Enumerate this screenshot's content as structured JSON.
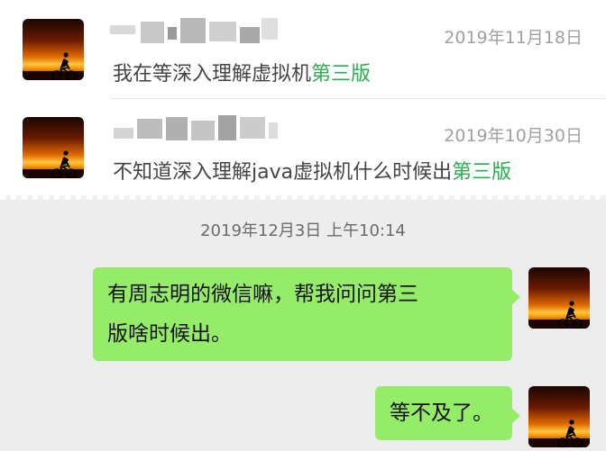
{
  "comments": [
    {
      "date": "2019年11月18日",
      "text_prefix": "我在等深入理解虚拟机",
      "text_highlight": "第三版"
    },
    {
      "date": "2019年10月30日",
      "text_prefix": "不知道深入理解java虚拟机什么时候出",
      "text_highlight": "第三版"
    }
  ],
  "chat": {
    "timestamp": "2019年12月3日 上午10:14",
    "messages": [
      {
        "line1": "有周志明的微信嘛，帮我问问第三",
        "line2": "版啥时候出。"
      },
      {
        "line1": "等不及了。"
      }
    ]
  },
  "colors": {
    "highlight": "#2dab50",
    "bubble": "#95ec69",
    "background": "#ededed"
  },
  "icons": {
    "avatar": "sunset-cyclist-avatar"
  }
}
